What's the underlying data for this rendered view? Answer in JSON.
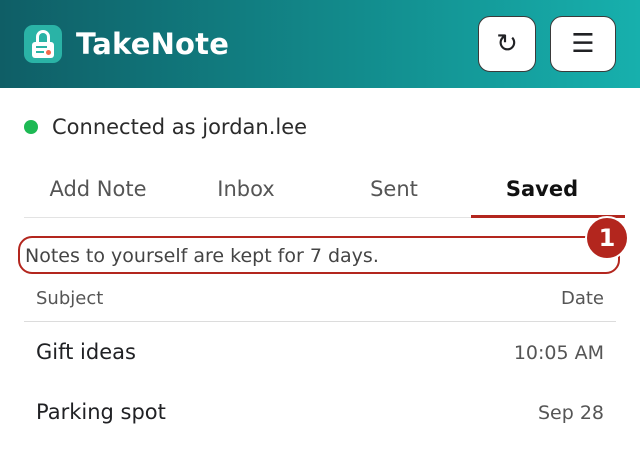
{
  "header": {
    "app_title": "TakeNote",
    "refresh_glyph": "↻",
    "menu_glyph": "☰",
    "colors": {
      "gradient_start": "#0f5e66",
      "gradient_end": "#17b0ad",
      "logo": "#2ab3a6"
    }
  },
  "status": {
    "text": "Connected as jordan.lee",
    "indicator_color": "#1db954"
  },
  "tabs": [
    {
      "label": "Add Note",
      "active": false
    },
    {
      "label": "Inbox",
      "active": false
    },
    {
      "label": "Sent",
      "active": false
    },
    {
      "label": "Saved",
      "active": true
    }
  ],
  "notice": {
    "text": "Notes to yourself are kept for 7 days.",
    "badge": "1",
    "highlight_color": "#b3261e"
  },
  "table": {
    "columns": {
      "subject": "Subject",
      "date": "Date"
    },
    "rows": [
      {
        "subject": "Gift ideas",
        "date": "10:05 AM"
      },
      {
        "subject": "Parking spot",
        "date": "Sep 28"
      }
    ]
  }
}
